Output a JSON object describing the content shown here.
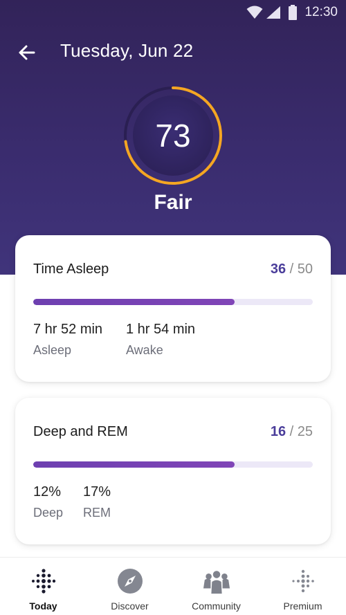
{
  "status_bar": {
    "time": "12:30"
  },
  "header": {
    "title": "Tuesday, Jun 22"
  },
  "score": {
    "value": "73",
    "label": "Fair",
    "progress_fraction": 0.73,
    "ring_color": "#f5a623"
  },
  "cards": [
    {
      "title": "Time Asleep",
      "score": "36",
      "max": "/ 50",
      "progress_fraction": 0.72,
      "stats": [
        {
          "value": "7 hr 52 min",
          "label": "Asleep"
        },
        {
          "value": "1 hr 54 min",
          "label": "Awake"
        }
      ]
    },
    {
      "title": "Deep and REM",
      "score": "16",
      "max": "/ 25",
      "progress_fraction": 0.72,
      "stats": [
        {
          "value": "12%",
          "label": "Deep"
        },
        {
          "value": "17%",
          "label": "REM"
        }
      ]
    }
  ],
  "bottom_nav": [
    {
      "label": "Today",
      "icon": "fitbit-dots-icon",
      "active": true
    },
    {
      "label": "Discover",
      "icon": "compass-icon",
      "active": false
    },
    {
      "label": "Community",
      "icon": "community-icon",
      "active": false
    },
    {
      "label": "Premium",
      "icon": "premium-dots-icon",
      "active": false
    }
  ],
  "colors": {
    "header": "#382a68",
    "accent": "#4a3d9a",
    "progress": "#7542b4"
  }
}
